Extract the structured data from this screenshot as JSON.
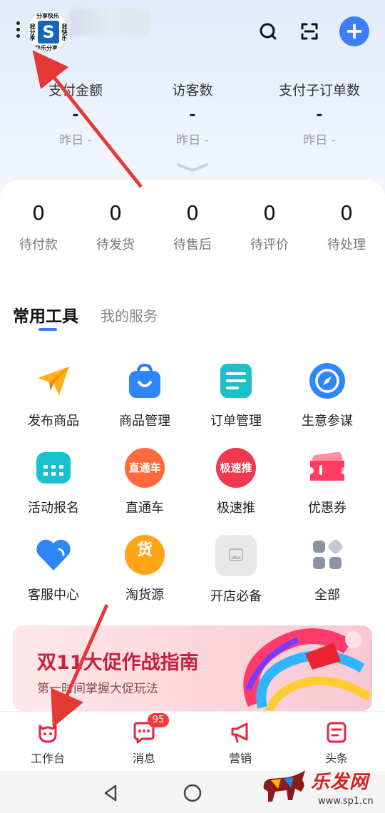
{
  "header": {
    "avatar_text_top": "分享快乐",
    "avatar_text_left": "我分享",
    "avatar_text_right": "我快乐",
    "avatar_text_bottom": "快乐分享",
    "avatar_letter": "S"
  },
  "stats": [
    {
      "label": "支付金额",
      "value": "-",
      "sub": "昨日 -"
    },
    {
      "label": "访客数",
      "value": "-",
      "sub": "昨日 -"
    },
    {
      "label": "支付子订单数",
      "value": "-",
      "sub": "昨日 -"
    }
  ],
  "orders": [
    {
      "count": "0",
      "label": "待付款"
    },
    {
      "count": "0",
      "label": "待发货"
    },
    {
      "count": "0",
      "label": "待售后"
    },
    {
      "count": "0",
      "label": "待评价"
    },
    {
      "count": "0",
      "label": "待处理"
    }
  ],
  "tabs": {
    "active": "常用工具",
    "inactive": "我的服务"
  },
  "tools": [
    {
      "label": "发布商品",
      "icon": "paper-plane-icon"
    },
    {
      "label": "商品管理",
      "icon": "shopping-bag-icon"
    },
    {
      "label": "订单管理",
      "icon": "document-icon"
    },
    {
      "label": "生意参谋",
      "icon": "compass-icon"
    },
    {
      "label": "活动报名",
      "icon": "calendar-icon"
    },
    {
      "label": "直通车",
      "icon": "ztc-icon",
      "badge_text": "直通车"
    },
    {
      "label": "极速推",
      "icon": "jst-icon",
      "badge_text": "极速推"
    },
    {
      "label": "优惠券",
      "icon": "coupon-icon"
    },
    {
      "label": "客服中心",
      "icon": "heart-icon"
    },
    {
      "label": "淘货源",
      "icon": "sourcing-icon",
      "badge_text": "货"
    },
    {
      "label": "开店必备",
      "icon": "image-placeholder-icon"
    },
    {
      "label": "全部",
      "icon": "grid-icon"
    }
  ],
  "banner": {
    "title": "双11大促作战指南",
    "subtitle": "第一时间掌握大促玩法"
  },
  "bottom_nav": [
    {
      "label": "工作台",
      "icon": "workbench-icon"
    },
    {
      "label": "消息",
      "icon": "message-icon",
      "badge": "95"
    },
    {
      "label": "营销",
      "icon": "megaphone-icon"
    },
    {
      "label": "头条",
      "icon": "news-icon"
    }
  ],
  "watermark": {
    "text": "乐发网",
    "url": "www.sp1.cn"
  },
  "colors": {
    "accent": "#3d7dfb",
    "banner_title": "#c81f3c",
    "badge": "#f23a3a",
    "arrow": "#e53935"
  }
}
